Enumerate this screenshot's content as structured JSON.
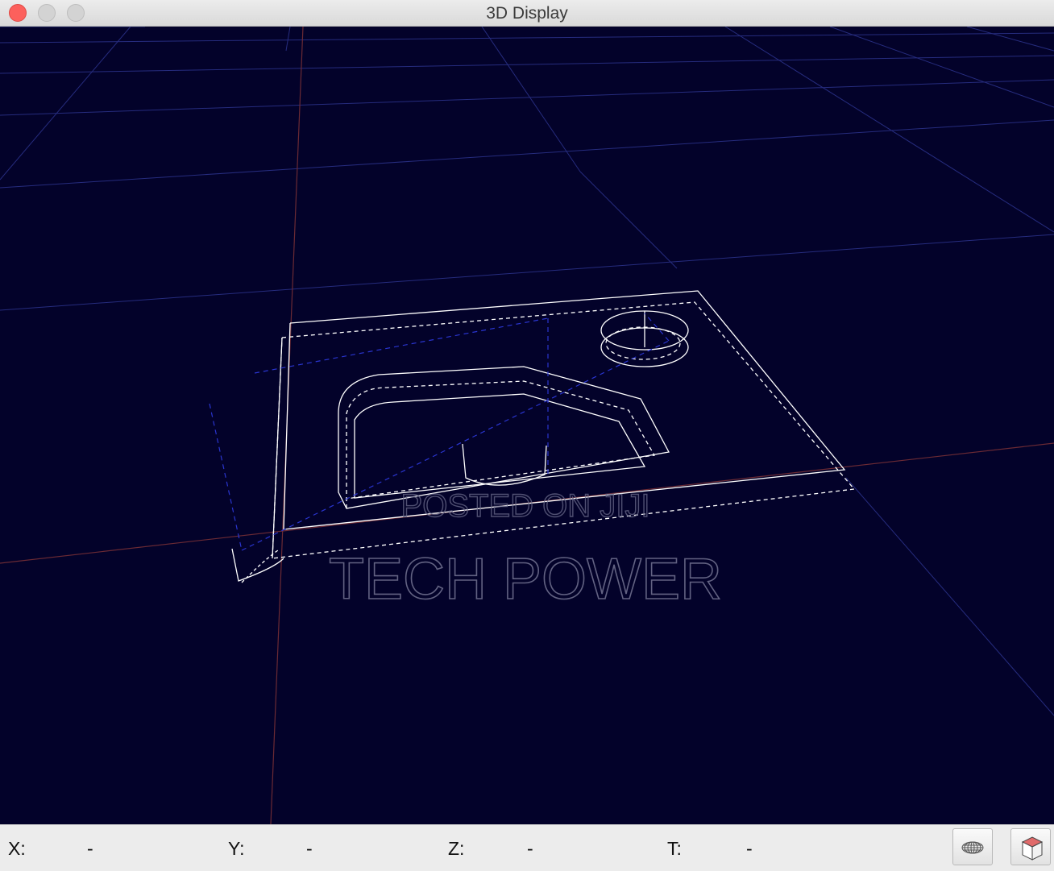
{
  "window": {
    "title": "3D Display"
  },
  "watermark": {
    "line1": "POSTED ON JIJI",
    "line2": "TECH POWER"
  },
  "status": {
    "x_label": "X:",
    "x_value": "-",
    "y_label": "Y:",
    "y_value": "-",
    "z_label": "Z:",
    "z_value": "-",
    "t_label": "T:",
    "t_value": "-"
  },
  "toolbar": {
    "icons": [
      "wireframe-toggle-icon",
      "view-cube-icon"
    ]
  },
  "colors": {
    "viewport_bg": "#03022a",
    "grid_line": "#2a2f8a",
    "axis_red": "#7a2a2a",
    "toolpath_white": "#ffffff",
    "toolpath_blue": "#2430c8",
    "window_close": "#fc605c"
  }
}
